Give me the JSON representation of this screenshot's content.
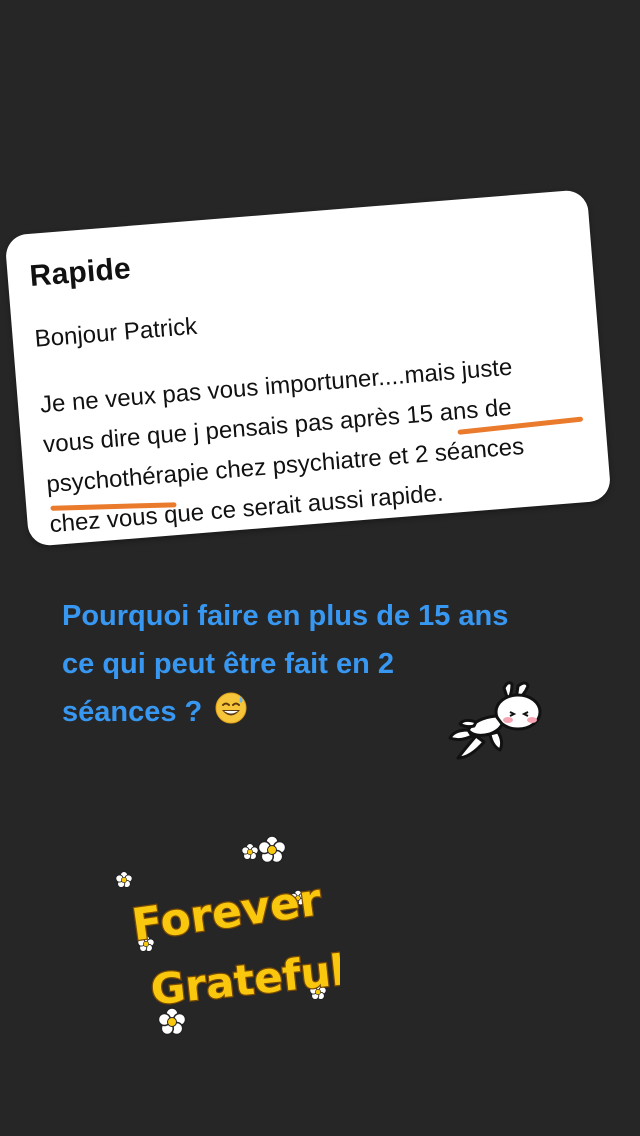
{
  "card": {
    "title": "Rapide",
    "greeting": "Bonjour Patrick",
    "lines": [
      "Je ne veux pas vous importuner....mais juste",
      "vous dire que j pensais pas après 15 ans de",
      "psychothérapie chez psychiatre et 2 séances",
      "chez vous que ce serait aussi rapide."
    ],
    "highlight_color": "#ea7a2c"
  },
  "caption": {
    "line1": "Pourquoi faire en plus de 15 ans",
    "line2": "ce qui peut être fait en 2",
    "line3": "séances ?",
    "emoji": "grinning-sweat-emoji",
    "color": "#3897f0"
  },
  "stickers": {
    "bunny": "running-bunny-sticker",
    "forever_grateful": {
      "word1": "Forever",
      "word2": "Grateful",
      "fill": "#f9c80e"
    }
  },
  "background": "#262626"
}
